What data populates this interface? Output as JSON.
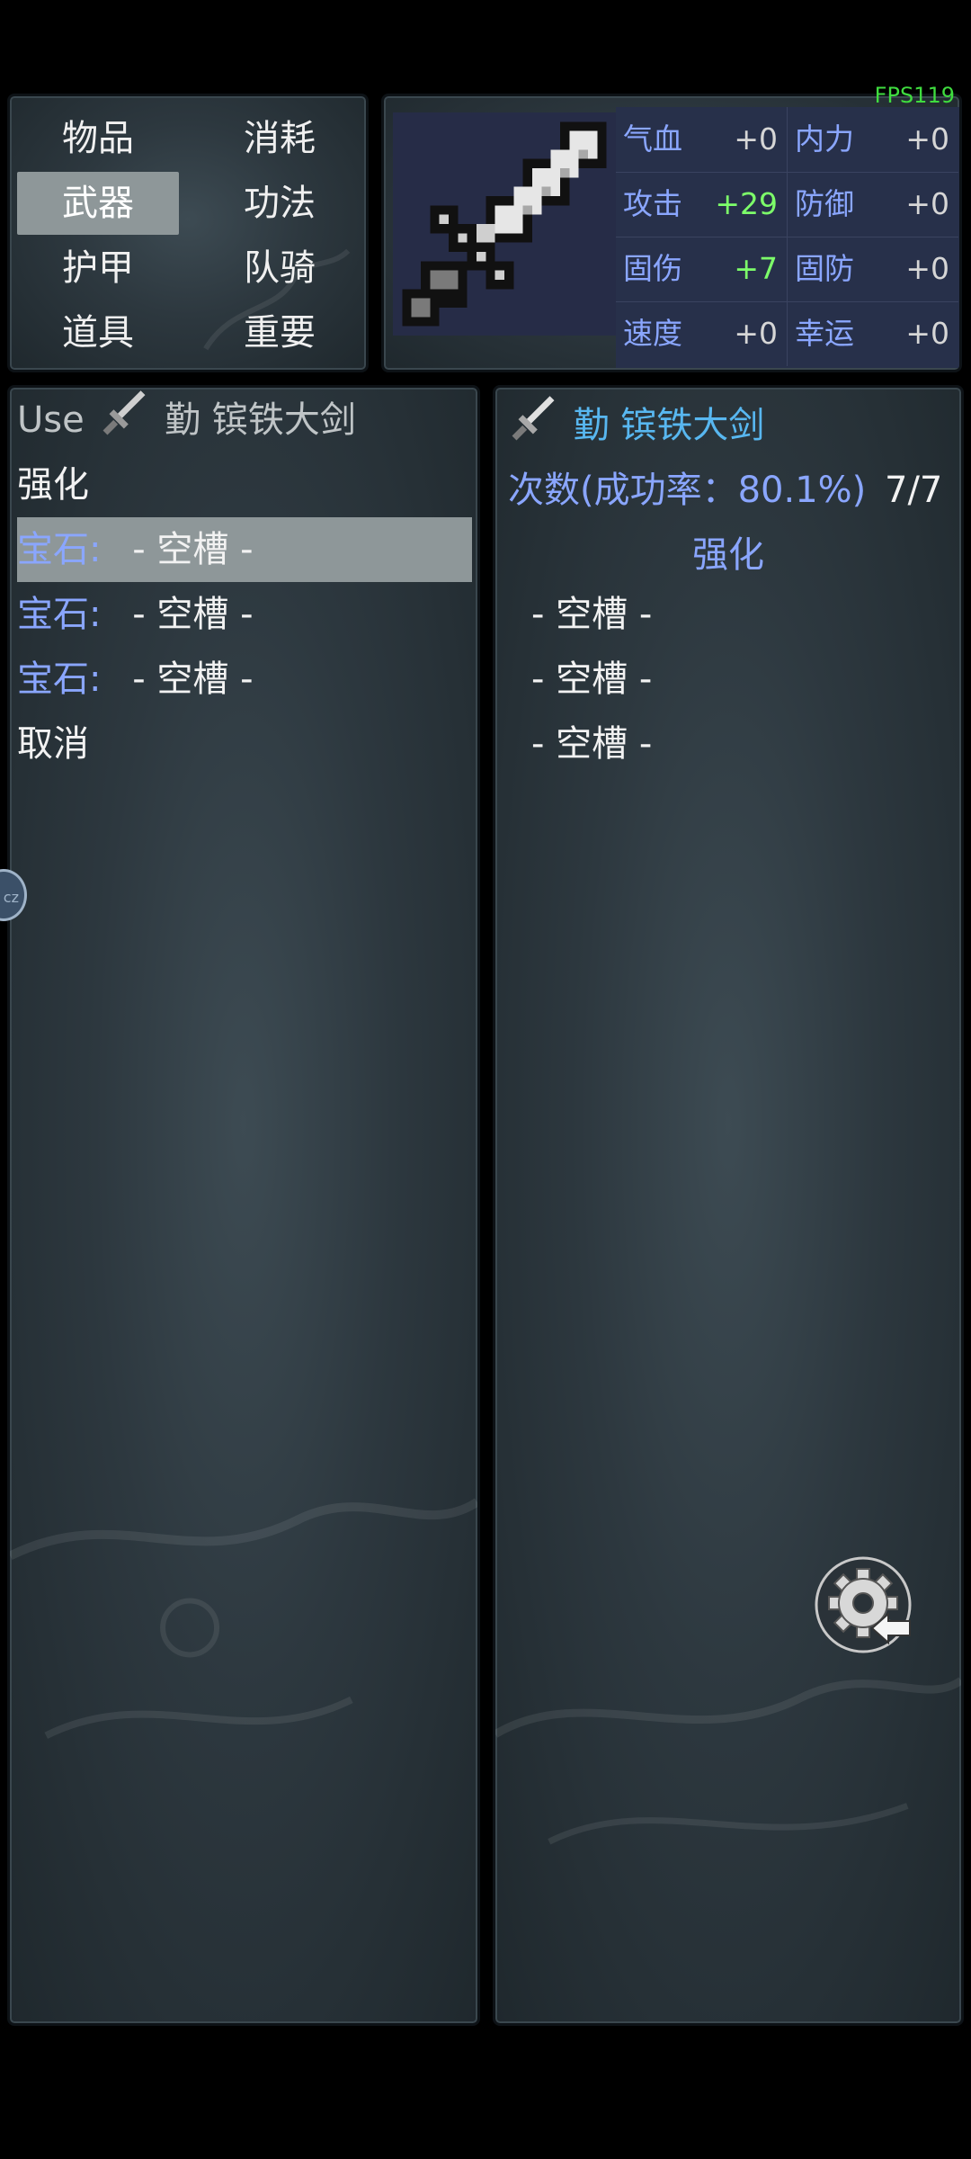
{
  "fps": "FPS119",
  "categories": [
    {
      "label": "物品",
      "selected": false
    },
    {
      "label": "消耗",
      "selected": false
    },
    {
      "label": "武器",
      "selected": true
    },
    {
      "label": "功法",
      "selected": false
    },
    {
      "label": "护甲",
      "selected": false
    },
    {
      "label": "队骑",
      "selected": false
    },
    {
      "label": "道具",
      "selected": false
    },
    {
      "label": "重要",
      "selected": false
    }
  ],
  "stats": [
    {
      "label": "气血",
      "value": "+0"
    },
    {
      "label": "内力",
      "value": "+0"
    },
    {
      "label": "攻击",
      "value": "+29"
    },
    {
      "label": "防御",
      "value": "+0"
    },
    {
      "label": "固伤",
      "value": "+7"
    },
    {
      "label": "固防",
      "value": "+0"
    },
    {
      "label": "速度",
      "value": "+0"
    },
    {
      "label": "幸运",
      "value": "+0"
    }
  ],
  "colors": {
    "stat_label": "#8aa6ff",
    "stat_bonus": "#7dff6a",
    "item_name": "#58b7f0",
    "fps": "#3fdc3f"
  },
  "list": {
    "header_prefix": "Use",
    "header_item": "勤 镔铁大剑",
    "enhance": "强化",
    "gem_label": "宝石:",
    "gem_slots": [
      "- 空槽 -",
      "- 空槽 -",
      "- 空槽 -"
    ],
    "selected_gem_index": 0,
    "cancel": "取消"
  },
  "detail": {
    "item_name": "勤 镔铁大剑",
    "count_label": "次数(成功率：80.1%)",
    "count_value": "7/7",
    "section": "强化",
    "slots": [
      "- 空槽 -",
      "- 空槽 -",
      "- 空槽 -"
    ]
  },
  "side_knob_label": "cz",
  "icons": {
    "item": "sword-icon",
    "settings": "gear-icon"
  }
}
